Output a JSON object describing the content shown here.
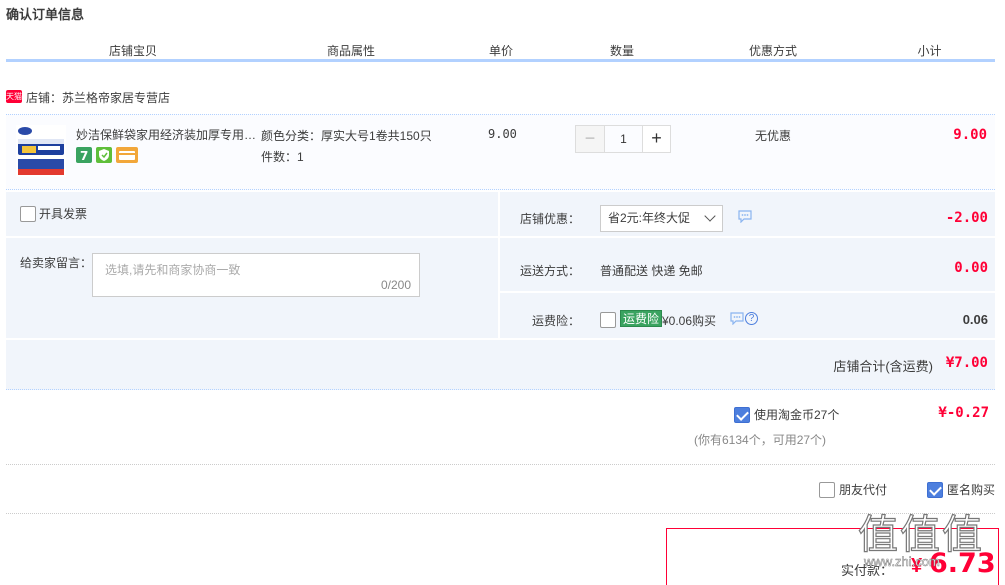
{
  "page": {
    "title": "确认订单信息"
  },
  "header": {
    "cols": [
      "店铺宝贝",
      "商品属性",
      "单价",
      "数量",
      "优惠方式",
      "小计"
    ]
  },
  "shop": {
    "badge": "天猫",
    "label": "店铺：苏兰格帝家居专营店"
  },
  "item": {
    "title": "妙洁保鲜袋家用经济装加厚专用…",
    "attr_color": "颜色分类：厚实大号1卷共150只",
    "attr_count": "件数：1",
    "unit_price": "9.00",
    "quantity": "1",
    "qty_minus": "−",
    "qty_plus": "+",
    "discount": "无优惠",
    "subtotal": "9.00",
    "service_icons": [
      "seven-day-return-icon",
      "shield-guarantee-icon",
      "credit-card-icon"
    ]
  },
  "options": {
    "invoice_label": "开具发票",
    "message_label": "给卖家留言：",
    "message_placeholder": "选填,请先和商家协商一致",
    "message_count": "0/200",
    "shop_discount_label": "店铺优惠：",
    "shop_discount_value": "省2元:年终大促",
    "shop_discount_amount": "-2.00",
    "shipping_label": "运送方式：",
    "shipping_value": "普通配送 快递 免邮",
    "shipping_price": "0.00",
    "insurance_label": "运费险：",
    "insurance_tag": "运费险",
    "insurance_text": "¥0.06购买",
    "insurance_help": "?",
    "insurance_price": "0.06",
    "shop_total_label": "店铺合计(含运费)",
    "shop_total_value": "¥7.00"
  },
  "coins": {
    "label": "使用淘金币27个",
    "value": "¥-0.27",
    "note": "(你有6134个，可用27个)",
    "checked": true
  },
  "extras": {
    "friend_pay": "朋友代付",
    "anonymous": "匿名购买"
  },
  "payment": {
    "label": "实付款：",
    "currency": "¥",
    "value": "6.73"
  },
  "watermark": {
    "chars": "值值值",
    "url": "www.zhi.com"
  },
  "colors": {
    "accent_red": "#ff0036",
    "header_border": "#b2d1ff",
    "option_bg": "#f1f5fb",
    "checkbox_blue": "#4d7fde",
    "insurance_green": "#3aa360"
  }
}
